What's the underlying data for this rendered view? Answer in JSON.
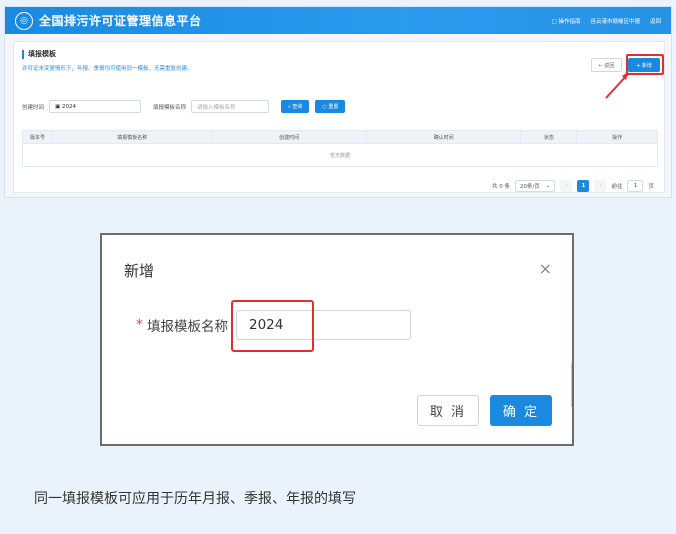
{
  "app": {
    "logo_glyph": "◎",
    "title": "全国排污许可证管理信息平台",
    "links": [
      "□ 操作指南",
      "连云港市赣榆区中德"
    ],
    "back_link": "返回"
  },
  "page": {
    "title": "填报模板",
    "description": "许可证未变更情形下，年报、季报均可使用同一模板，无需重复创建。",
    "back_button": "← 返回",
    "add_button": "+ 新增"
  },
  "filters": {
    "created_label": "创建时间",
    "created_value": "▣ 2024",
    "name_label": "填报模板名称",
    "name_placeholder": "请输入模板名称",
    "search_button": "⌕ 查询",
    "reset_button": "○ 重置"
  },
  "table": {
    "headers": [
      "版本号",
      "填报模板名称",
      "创建时间",
      "确认时间",
      "状态",
      "操作"
    ],
    "empty_text": "暂无数据"
  },
  "pagination": {
    "total": "共 0 条",
    "page_size": "20条/页",
    "page_size_caret": "⌄",
    "prev": "‹",
    "current_page": "1",
    "next": "›",
    "goto_label": "前往",
    "goto_value": "1",
    "goto_suffix": "页"
  },
  "modal": {
    "title": "新增",
    "close_glyph": "×",
    "required_mark": "*",
    "field_label": "填报模板名称",
    "field_value": "2024",
    "cancel_button": "取 消",
    "ok_button": "确 定"
  },
  "caption": "同一填报模板可应用于历年月报、季报、年报的填写",
  "colors": {
    "primary": "#1a8ae0",
    "highlight": "#e02f2f"
  }
}
